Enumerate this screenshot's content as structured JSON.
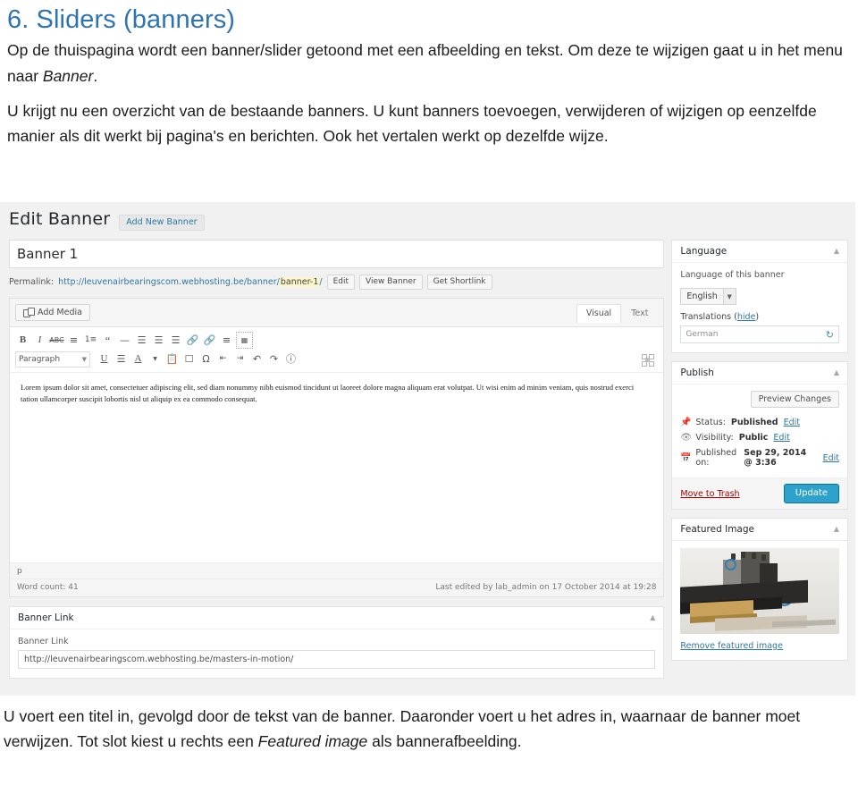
{
  "document": {
    "heading": "6. Sliders (banners)",
    "paragraph1_part1": "Op de thuispagina wordt een banner/slider getoond met een afbeelding en tekst. Om deze te wijzigen gaat u in het menu naar ",
    "paragraph1_italic": "Banner",
    "paragraph1_part2": ".",
    "paragraph2": "U krijgt nu een overzicht van de bestaande banners. U kunt banners toevoegen, verwijderen of wijzigen op eenzelfde manier als dit werkt bij pagina's en berichten. Ook het vertalen werkt op dezelfde wijze.",
    "paragraph3_part1": "U voert een titel in, gevolgd door de tekst van de banner. Daaronder voert u het adres in, waarnaar de banner moet verwijzen. Tot slot kiest u rechts een ",
    "paragraph3_italic": "Featured image",
    "paragraph3_part2": " als bannerafbeelding.",
    "heading_color": "#2e74b5"
  },
  "screenshot": {
    "page_heading": "Edit Banner",
    "add_new_button": "Add New Banner",
    "title_field": {
      "value": "Banner 1"
    },
    "permalink": {
      "label": "Permalink:",
      "url_prefix": "http://leuvenairbearingscom.webhosting.be/banner/",
      "slug": "banner-1",
      "url_suffix": "/",
      "edit_button": "Edit",
      "view_button": "View Banner",
      "shortlink_button": "Get Shortlink"
    },
    "editor": {
      "add_media": "Add Media",
      "tab_visual": "Visual",
      "tab_text": "Text",
      "format_select": "Paragraph",
      "content": "Lorem ipsum dolor sit amet, consectetuer adipiscing elit, sed diam nonummy nibh euismod tincidunt ut laoreet dolore magna aliquam erat volutpat. Ut wisi enim ad minim veniam, quis nostrud exerci tation ullamcorper suscipit lobortis nisl ut aliquip ex ea commodo consequat.",
      "path": "p",
      "word_count": "Word count: 41",
      "last_edited": "Last edited by lab_admin on 17 October 2014 at 19:28",
      "toolbar_row1": [
        "B",
        "I",
        "ABC",
        "bullet-list",
        "numbered-list",
        "blockquote",
        "horizontal-rule",
        "align-left",
        "align-center",
        "align-right",
        "insert-link",
        "unlink",
        "read-more",
        "kitchen-sink"
      ],
      "toolbar_row2": [
        "underline",
        "justify",
        "text-color",
        "paste-as-text",
        "clear-formatting",
        "special-character",
        "outdent",
        "indent",
        "undo",
        "redo",
        "help"
      ]
    },
    "banner_link_box": {
      "title": "Banner Link",
      "field_label": "Banner Link",
      "value": "http://leuvenairbearingscom.webhosting.be/masters-in-motion/"
    },
    "language_box": {
      "title": "Language",
      "subtitle": "Language of this banner",
      "selected": "English",
      "translations_label": "Translations",
      "translations_toggle": "hide",
      "translation_row": "German"
    },
    "publish_box": {
      "title": "Publish",
      "preview_button": "Preview Changes",
      "status_label": "Status:",
      "status_value": "Published",
      "status_edit": "Edit",
      "visibility_label": "Visibility:",
      "visibility_value": "Public",
      "visibility_edit": "Edit",
      "published_label": "Published on:",
      "published_value": "Sep 29, 2014 @ 3:36",
      "published_edit": "Edit",
      "trash_link": "Move to Trash",
      "update_button": "Update",
      "update_color": "#2ea2cc"
    },
    "featured_image_box": {
      "title": "Featured Image",
      "remove_link": "Remove featured image"
    }
  }
}
